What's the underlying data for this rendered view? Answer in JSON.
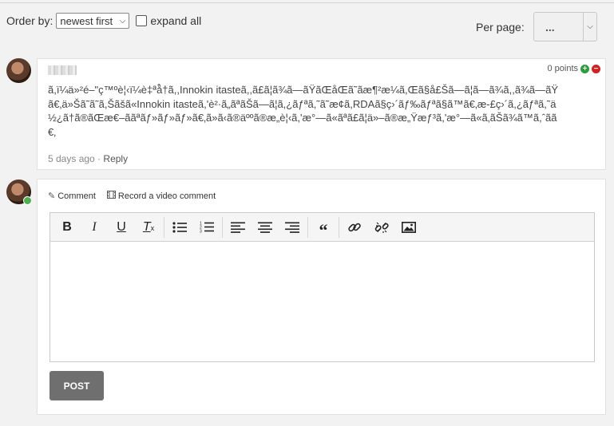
{
  "controls": {
    "order_label": "Order by:",
    "order_value": "newest first",
    "expand_label": "expand all",
    "perpage_label": "Per page:",
    "perpage_value": "..."
  },
  "comment": {
    "points": "0 points",
    "text": "ã,ï¼ä»²é–\"ç™ºè¦‹ï¼è‡ªå̂†ã,,Innokin itasteã,,ã£ã¦ã¾ã—ãŸãŒåŒã˜ãæ¶²æ¼ã,Œã§å£Šã—ã¦ã—ã¾ã,,ã¾ã—ãŸã€‚ä»Šã˜ã˜ã,Šãšã«Innokin itasteã,'è²·ã„ãªãŠã—ã¦ã,¿ãƒªã,˜ã˜æ¢ã,RDAã§ç›´ãƒ‰ãƒªã§ã™ã€‚æ-£ç›´ã,¿ãƒªã,˜ä½¿ã†ã®ãŒæ€–ããªãƒ»ãƒ»ãƒ»ã€‚ã»ã‹ã®äººã®æ„è¦‹ã,'æ°—ã«ãªã£ã¦ä»–ã®æ„Ÿæƒ³ã,'æ°—ã«ã‚ãŠã¾ã™ã,ˆãã€‚",
    "time": "5 days ago",
    "separator": "·",
    "reply": "Reply"
  },
  "composer": {
    "tab_comment": "Comment",
    "tab_video": "Record a video comment",
    "post_label": "POST"
  },
  "toolbar_icons": [
    "bold-icon",
    "italic-icon",
    "underline-icon",
    "clear-format-icon",
    "bullet-list-icon",
    "numbered-list-icon",
    "align-left-icon",
    "align-center-icon",
    "align-right-icon",
    "quote-icon",
    "link-icon",
    "unlink-icon",
    "image-icon"
  ],
  "colors": {
    "vote_up": "#2e9e3a",
    "vote_down": "#d32020",
    "post_button": "#6f6f6f",
    "online": "#4caf50"
  }
}
